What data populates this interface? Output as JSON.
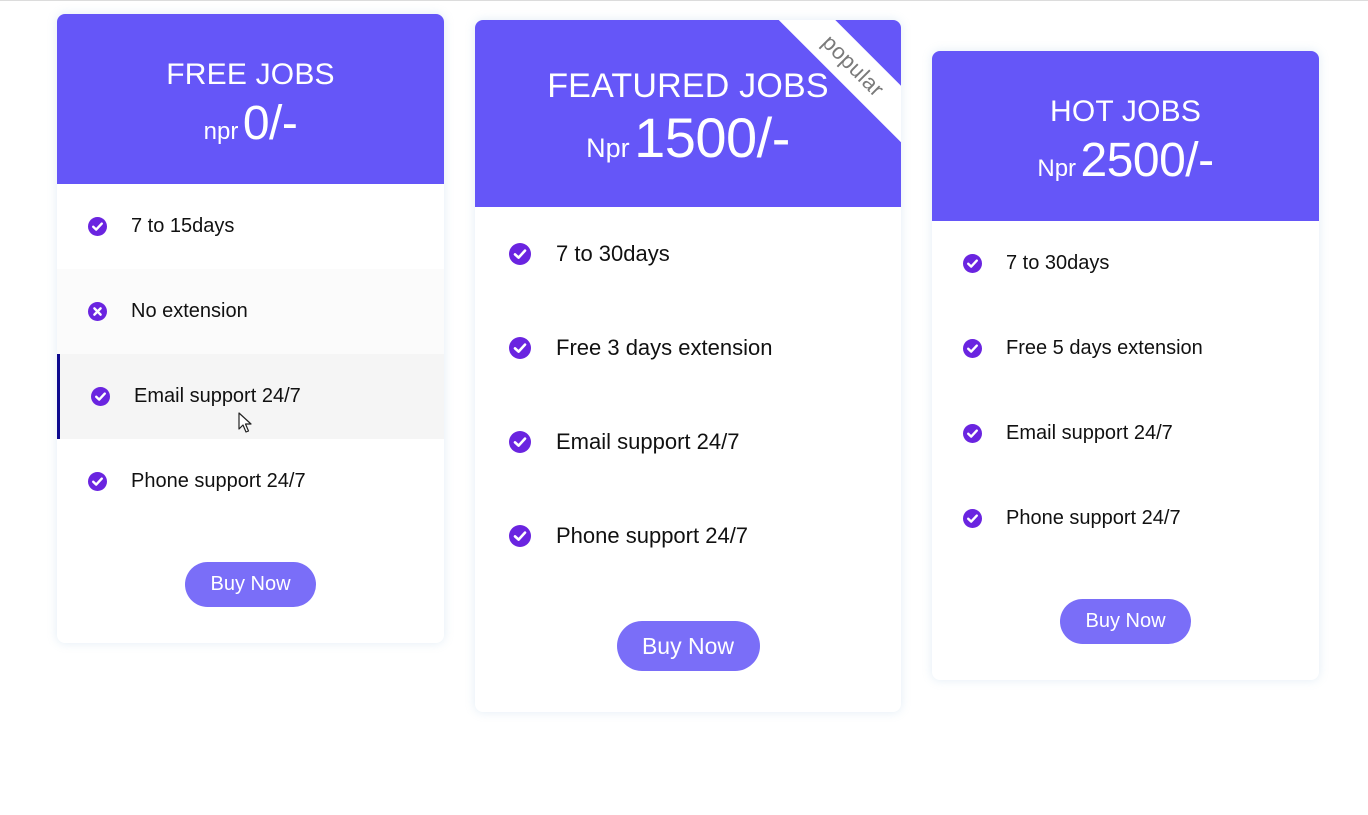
{
  "colors": {
    "header_bg": "#6556f8",
    "icon_purple": "#6a24e0",
    "button_bg": "#7a6ef8",
    "hover_bar": "#0e0a8f"
  },
  "plans": [
    {
      "title": "FREE JOBS",
      "currency": "npr",
      "amount": "0/-",
      "features": [
        {
          "text": "7 to 15days",
          "icon": "check-circle-icon"
        },
        {
          "text": "No extension",
          "icon": "x-circle-icon"
        },
        {
          "text": "Email support 24/7",
          "icon": "check-circle-icon"
        },
        {
          "text": "Phone support 24/7",
          "icon": "check-circle-icon"
        }
      ],
      "button_label": "Buy Now"
    },
    {
      "title": "FEATURED JOBS",
      "currency": "Npr",
      "amount": "1500/-",
      "ribbon": "popular",
      "features": [
        {
          "text": "7 to 30days",
          "icon": "check-circle-icon"
        },
        {
          "text": "Free 3 days extension",
          "icon": "check-circle-icon"
        },
        {
          "text": "Email support 24/7",
          "icon": "check-circle-icon"
        },
        {
          "text": "Phone support 24/7",
          "icon": "check-circle-icon"
        }
      ],
      "button_label": "Buy Now"
    },
    {
      "title": "HOT JOBS",
      "currency": "Npr",
      "amount": "2500/-",
      "features": [
        {
          "text": "7 to 30days",
          "icon": "check-circle-icon"
        },
        {
          "text": "Free 5 days extension",
          "icon": "check-circle-icon"
        },
        {
          "text": "Email support 24/7",
          "icon": "check-circle-icon"
        },
        {
          "text": "Phone support 24/7",
          "icon": "check-circle-icon"
        }
      ],
      "button_label": "Buy Now"
    }
  ]
}
